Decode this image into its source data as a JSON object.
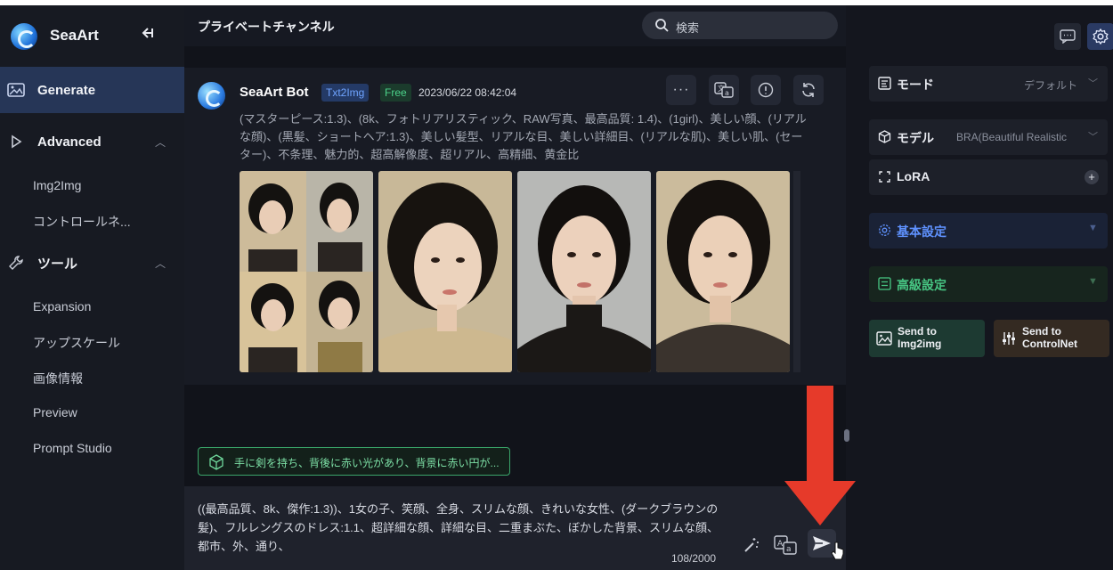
{
  "sidebar": {
    "brand": "SeaArt",
    "collapse_icon": "collapse-arrow-icon",
    "items": [
      {
        "label": "Generate",
        "icon": "image-icon",
        "active": true
      },
      {
        "label": "Advanced",
        "icon": "play-icon"
      },
      {
        "label": "ツール",
        "icon": "wrench-icon"
      }
    ],
    "advanced_sub": [
      "Img2Img",
      "コントロールネ..."
    ],
    "tools_sub": [
      "Expansion",
      "アップスケール",
      "画像情報",
      "Preview",
      "Prompt Studio"
    ]
  },
  "header": {
    "channel_title": "プライベートチャンネル",
    "search_placeholder": "検索"
  },
  "message": {
    "bot_name": "SeaArt Bot",
    "mode_badge": "Txt2Img",
    "plan_badge": "Free",
    "timestamp": "2023/06/22 08:42:04",
    "prompt": "(マスターピース:1.3)、(8k、フォトリアリスティック、RAW写真、最高品質: 1.4)、(1girl)、美しい顔、(リアルな顔)、(黒髪、ショートヘア:1.3)、美しい髪型、リアルな目、美しい詳細目、(リアルな肌)、美しい肌、(セーター)、不条理、魅力的、超高解像度、超リアル、高精細、黄金比",
    "actions": [
      "more-icon",
      "translate-icon",
      "info-icon",
      "refresh-icon"
    ],
    "images": [
      "grid-preview",
      "portrait-1",
      "portrait-2",
      "portrait-3"
    ]
  },
  "suggestion": {
    "icon": "dice-icon",
    "text": "手に剣を持ち、背後に赤い光があり、背景に赤い円が..."
  },
  "composer": {
    "text": "((最高品質、8k、傑作:1.3))、1女の子、笑顔、全身、スリムな顔、きれいな女性、(ダークブラウンの髪)、フルレングスのドレス:1.1、超詳細な顔、詳細な目、二重まぶた、ぼかした背景、スリムな顔、都市、外、通り、",
    "counter": "108/2000",
    "buttons": [
      "magic-wand-icon",
      "translate-icon",
      "send-icon"
    ]
  },
  "right_panel": {
    "top_buttons": [
      "chat-icon",
      "settings-gear-icon"
    ],
    "mode_label": "モード",
    "mode_value": "デフォルト",
    "model_label": "モデル",
    "model_value": "BRA(Beautiful Realistic",
    "lora_label": "LoRA",
    "basic_label": "基本設定",
    "advanced_label": "高級設定",
    "send_img2img_line1": "Send to",
    "send_img2img_line2": "Img2img",
    "send_controlnet_line1": "Send to",
    "send_controlnet_line2": "ControlNet"
  },
  "colors": {
    "accent_blue": "#5f92ff",
    "accent_green": "#47c683",
    "annotation_arrow": "#e63a2a",
    "active_nav": "#263657"
  }
}
